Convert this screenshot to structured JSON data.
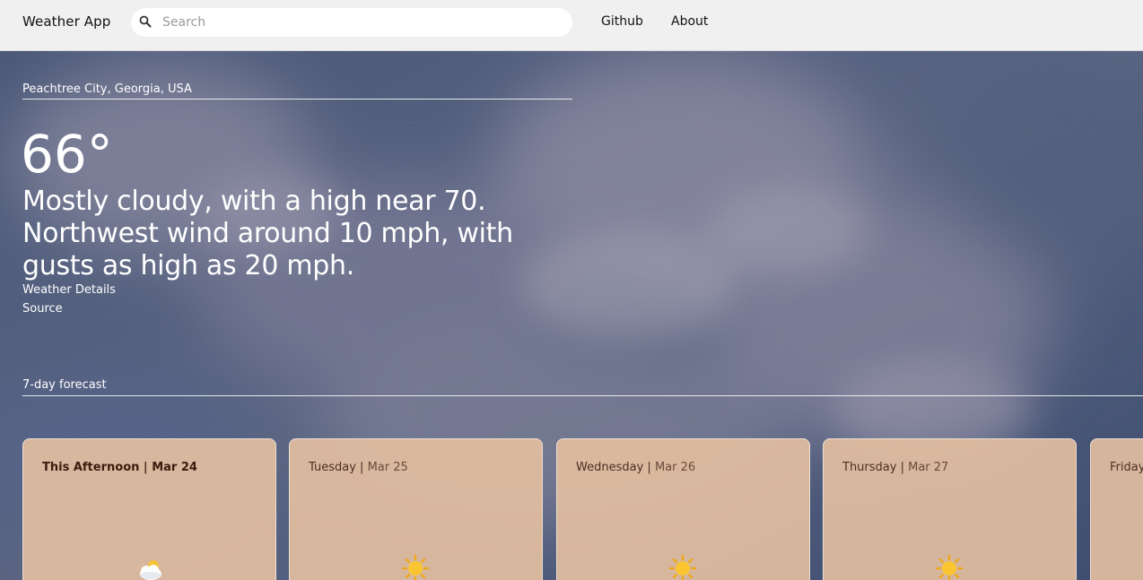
{
  "app": {
    "title": "Weather App"
  },
  "search": {
    "placeholder": "Search",
    "value": ""
  },
  "nav": {
    "github": "Github",
    "about": "About"
  },
  "current": {
    "location": "Peachtree City, Georgia, USA",
    "temperature": "66°",
    "summary": "Mostly cloudy, with a high near 70. Northwest wind around 10 mph, with gusts as high as 20 mph.",
    "details_link": "Weather Details",
    "source_link": "Source"
  },
  "forecast": {
    "title": "7-day forecast",
    "separator": "|",
    "days": [
      {
        "name": "This Afternoon",
        "date": "Mar 24",
        "icon": "partly-cloudy-icon"
      },
      {
        "name": "Tuesday",
        "date": "Mar 25",
        "icon": "sun-icon"
      },
      {
        "name": "Wednesday",
        "date": "Mar 26",
        "icon": "sun-icon"
      },
      {
        "name": "Thursday",
        "date": "Mar 27",
        "icon": "sun-icon"
      },
      {
        "name": "Friday",
        "date": "",
        "icon": ""
      }
    ]
  },
  "colors": {
    "topbar": "#f0f0f0",
    "sky": "#485676",
    "card": "#e2bea0",
    "card_text": "#4a2f22"
  }
}
